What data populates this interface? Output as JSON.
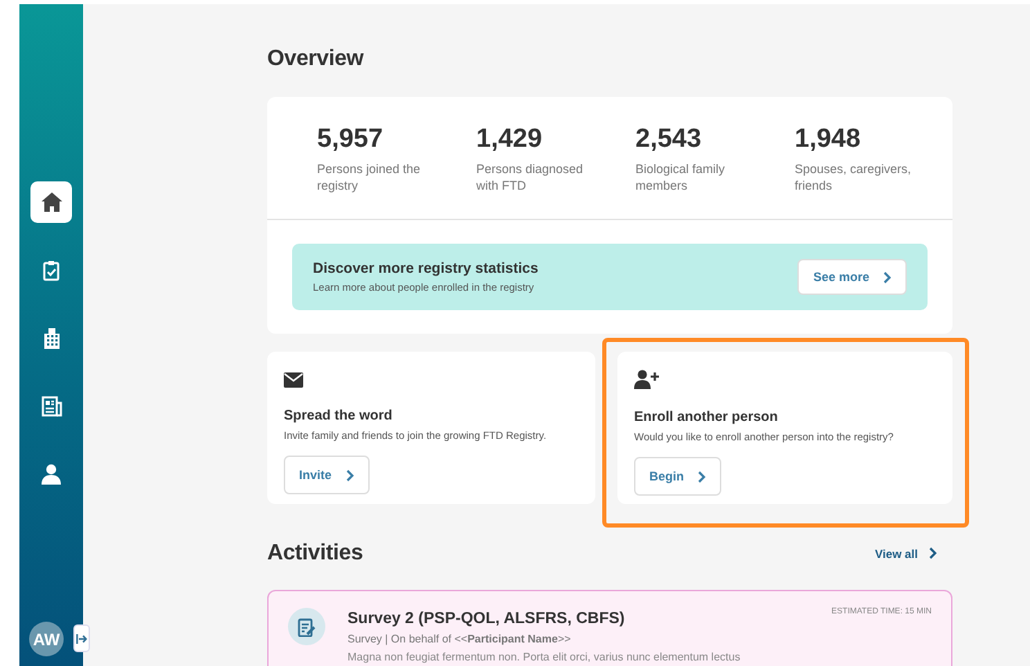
{
  "sidebar": {
    "items": [
      {
        "kind": "home",
        "selected": true
      },
      {
        "kind": "clipboard",
        "selected": false
      },
      {
        "kind": "building",
        "selected": false
      },
      {
        "kind": "newspaper",
        "selected": false
      },
      {
        "kind": "person",
        "selected": false
      }
    ],
    "avatar": "AW"
  },
  "overview": {
    "title": "Overview",
    "stats": [
      {
        "value": "5,957",
        "label": "Persons joined the registry"
      },
      {
        "value": "1,429",
        "label": "Persons diagnosed with FTD"
      },
      {
        "value": "2,543",
        "label": "Biological family members"
      },
      {
        "value": "1,948",
        "label": "Spouses, caregivers, friends"
      }
    ],
    "banner": {
      "title": "Discover more registry statistics",
      "text": "Learn more about people enrolled in the registry",
      "button": "See more"
    }
  },
  "cards": [
    {
      "kind": "mail",
      "title": "Spread the word",
      "text": "Invite family and friends to join the growing FTD Registry.",
      "button": "Invite",
      "highlighted": false
    },
    {
      "kind": "person-add",
      "title": "Enroll another person",
      "text": "Would you like to enroll another person into the registry?",
      "button": "Begin",
      "highlighted": true
    }
  ],
  "activities": {
    "title": "Activities",
    "link": "View all",
    "items": [
      {
        "title": "Survey 2 (PSP-QOL, ALSFRS, CBFS)",
        "meta": "Survey | On behalf of <<**Participant Name**>>",
        "time": "ESTIMATED TIME: 15 MIN",
        "text": "Magna non feugiat fermentum non. Porta elit orci, varius nunc elementum lectus"
      }
    ]
  }
}
